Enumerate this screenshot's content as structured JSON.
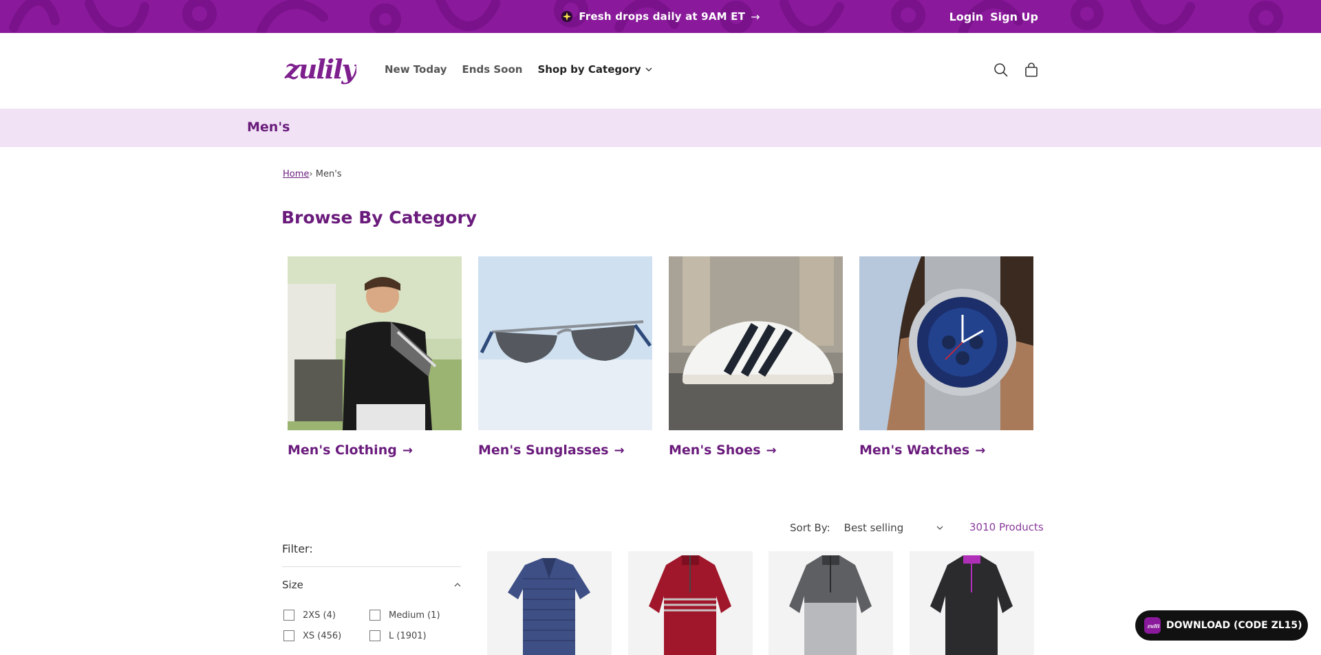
{
  "announcement": {
    "message": "Fresh drops daily at 9AM ET",
    "arrow": "→"
  },
  "auth": {
    "login": "Login",
    "signup": "Sign Up"
  },
  "header": {
    "logo_text": "Zulily",
    "nav": [
      {
        "label": "New Today"
      },
      {
        "label": "Ends Soon"
      },
      {
        "label": "Shop by Category"
      }
    ]
  },
  "category_strip": {
    "title": "Men's"
  },
  "breadcrumb": {
    "home": "Home",
    "separator": "›",
    "current": "Men's"
  },
  "browse": {
    "title": "Browse By Category",
    "cards": [
      {
        "label": "Men's Clothing",
        "image_icon": "golf-shirt-man"
      },
      {
        "label": "Men's Sunglasses",
        "image_icon": "sunglasses"
      },
      {
        "label": "Men's Shoes",
        "image_icon": "sneaker"
      },
      {
        "label": "Men's Watches",
        "image_icon": "wristwatch"
      }
    ],
    "arrow": "→"
  },
  "sort": {
    "label": "Sort By:",
    "selected": "Best selling",
    "count": "3010 Products"
  },
  "filters": {
    "label": "Filter:",
    "size_heading": "Size",
    "size_options": [
      "2XS (4)",
      "Medium (1)",
      "XS (456)",
      "L (1901)"
    ]
  },
  "products": [
    {
      "image_icon": "navy-polo"
    },
    {
      "image_icon": "red-quarter-zip"
    },
    {
      "image_icon": "grey-quarter-zip"
    },
    {
      "image_icon": "black-quarter-zip"
    }
  ],
  "download_button": {
    "label": "DOWNLOAD (CODE ZL15)"
  },
  "colors": {
    "brand_purple": "#8a1a9b",
    "title_purple": "#6a1b7c",
    "strip_bg": "#f1e3f5"
  }
}
